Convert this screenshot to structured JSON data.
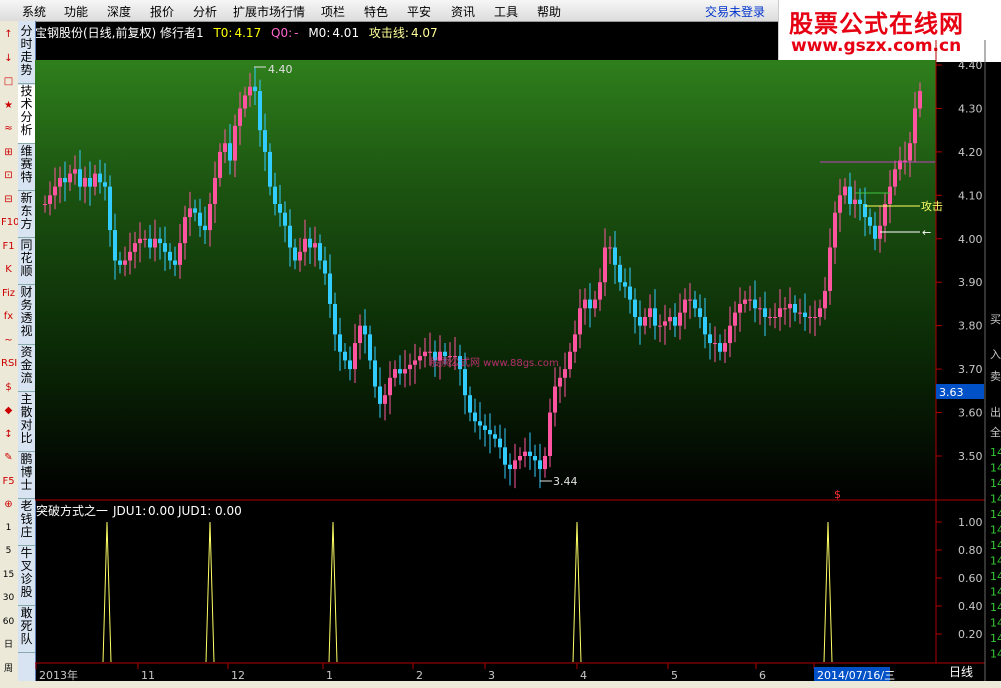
{
  "menu": [
    "系统",
    "功能",
    "深度",
    "报价",
    "分析",
    "扩展市场行情",
    "项栏",
    "特色",
    "平安",
    "资讯",
    "工具",
    "帮助"
  ],
  "login": "交易未登录",
  "logo": {
    "line1": "股票公式在线网",
    "line2": "www.gszx.com.cn"
  },
  "left_toolbar": [
    "↑",
    "↓",
    "□",
    "★",
    "≈",
    "⊞",
    "⊡",
    "⊟",
    "F10",
    "F1",
    "K",
    "Fiz",
    "fx",
    "~",
    "RSI",
    "$",
    "◆",
    "↕",
    "✎",
    "F5",
    "⊕",
    "1",
    "5",
    "15",
    "30",
    "60",
    "日",
    "周"
  ],
  "vtabs": [
    "分时走势",
    "技术分析",
    "维赛特",
    "新东方",
    "同花顺",
    "财务透视",
    "资金流",
    "主散对比",
    "鹏博士",
    "老钱庄",
    "牛叉诊股",
    "敢死队"
  ],
  "info": {
    "title": "宝钢股份(日线,前复权) 修行者1",
    "t0_label": "T0:",
    "t0_value": "4.17",
    "q0_label": "Q0:",
    "q0_value": "-",
    "m0_label": "M0:",
    "m0_value": "4.01",
    "attack_label": "攻击线:",
    "attack_value": "4.07"
  },
  "annot": {
    "high": "4.40",
    "low": "3.44",
    "attack_tag": "攻击",
    "arrow_tag": "←",
    "watermark": "股票公式网 www.88gs.com",
    "dollar": "$"
  },
  "price_axis": [
    "4.40",
    "4.30",
    "4.20",
    "4.10",
    "4.00",
    "3.90",
    "3.80",
    "3.70",
    "3.60",
    "3.50"
  ],
  "current_price": "3.63",
  "indicator": {
    "title": "突破方式之一",
    "jdu1_label": "JDU1:",
    "jdu1": "0.00",
    "jud1_label": "JUD1:",
    "jud1": "0.00"
  },
  "ind_axis": [
    "1.00",
    "0.80",
    "0.60",
    "0.40",
    "0.20"
  ],
  "date_axis": [
    "2013年",
    "11",
    "12",
    "1",
    "2",
    "3",
    "4",
    "5",
    "6",
    "2014/07/16/三"
  ],
  "period_tab": "日线",
  "right_side": [
    "买",
    "入",
    "卖",
    "出",
    "全",
    "14",
    "14",
    "14",
    "14",
    "14",
    "14",
    "14",
    "14",
    "14",
    "14",
    "14",
    "14",
    "14",
    "14"
  ],
  "colors": {
    "up": "#ff55a0",
    "down": "#33ccff",
    "axis": "#b00000",
    "gold": "#ffff66"
  },
  "chart_data": {
    "type": "candlestick",
    "price_range": [
      3.4,
      4.42
    ],
    "ohlc_approx": "daily K-line, high 4.40, low 3.44",
    "indicator_spikes": [
      1,
      1,
      1,
      1,
      1
    ]
  }
}
